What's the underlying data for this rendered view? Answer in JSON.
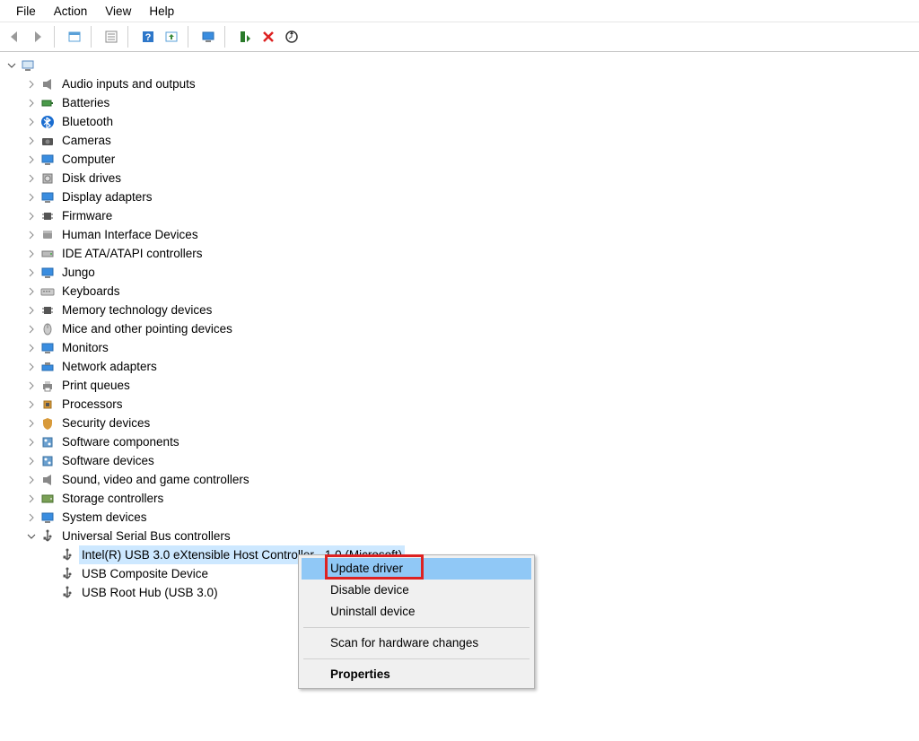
{
  "menu": {
    "file": "File",
    "action": "Action",
    "view": "View",
    "help": "Help"
  },
  "toolbar_icons": [
    "back",
    "forward",
    "show-hidden",
    "properties",
    "help",
    "update-driver",
    "computer",
    "install",
    "delete",
    "scan"
  ],
  "tree": {
    "root": {
      "label": "",
      "expanded": true
    },
    "categories": [
      {
        "id": "audio",
        "label": "Audio inputs and outputs",
        "icon": "speaker"
      },
      {
        "id": "batteries",
        "label": "Batteries",
        "icon": "battery"
      },
      {
        "id": "bluetooth",
        "label": "Bluetooth",
        "icon": "bluetooth"
      },
      {
        "id": "cameras",
        "label": "Cameras",
        "icon": "camera"
      },
      {
        "id": "computer",
        "label": "Computer",
        "icon": "monitor"
      },
      {
        "id": "disk",
        "label": "Disk drives",
        "icon": "disk"
      },
      {
        "id": "display",
        "label": "Display adapters",
        "icon": "monitor"
      },
      {
        "id": "firmware",
        "label": "Firmware",
        "icon": "chip"
      },
      {
        "id": "hid",
        "label": "Human Interface Devices",
        "icon": "hid"
      },
      {
        "id": "ide",
        "label": "IDE ATA/ATAPI controllers",
        "icon": "drive"
      },
      {
        "id": "jungo",
        "label": "Jungo",
        "icon": "monitor"
      },
      {
        "id": "keyboards",
        "label": "Keyboards",
        "icon": "keyboard"
      },
      {
        "id": "memory",
        "label": "Memory technology devices",
        "icon": "chip"
      },
      {
        "id": "mice",
        "label": "Mice and other pointing devices",
        "icon": "mouse"
      },
      {
        "id": "monitors",
        "label": "Monitors",
        "icon": "monitor"
      },
      {
        "id": "network",
        "label": "Network adapters",
        "icon": "network"
      },
      {
        "id": "print",
        "label": "Print queues",
        "icon": "printer"
      },
      {
        "id": "processors",
        "label": "Processors",
        "icon": "cpu"
      },
      {
        "id": "security",
        "label": "Security devices",
        "icon": "shield"
      },
      {
        "id": "softcomp",
        "label": "Software components",
        "icon": "component"
      },
      {
        "id": "softdev",
        "label": "Software devices",
        "icon": "component"
      },
      {
        "id": "sound",
        "label": "Sound, video and game controllers",
        "icon": "speaker"
      },
      {
        "id": "storage",
        "label": "Storage controllers",
        "icon": "storage"
      },
      {
        "id": "system",
        "label": "System devices",
        "icon": "monitor"
      },
      {
        "id": "usb",
        "label": "Universal Serial Bus controllers",
        "icon": "usb",
        "expanded": true,
        "children": [
          {
            "id": "usb0",
            "label": "Intel(R) USB 3.0 eXtensible Host Controller - 1.0 (Microsoft)",
            "icon": "usb",
            "selected": true
          },
          {
            "id": "usb1",
            "label": "USB Composite Device",
            "icon": "usb"
          },
          {
            "id": "usb2",
            "label": "USB Root Hub (USB 3.0)",
            "icon": "usb"
          }
        ]
      }
    ]
  },
  "context_menu": {
    "update": "Update driver",
    "disable": "Disable device",
    "uninstall": "Uninstall device",
    "scan": "Scan for hardware changes",
    "properties": "Properties"
  }
}
